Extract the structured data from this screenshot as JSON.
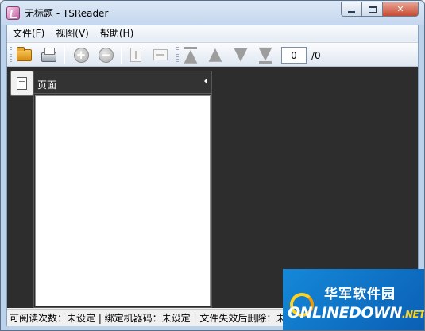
{
  "window": {
    "title": "无标题 - TSReader"
  },
  "menu": [
    "文件(F)",
    "视图(V)",
    "帮助(H)"
  ],
  "toolbar": {
    "buttons": [
      {
        "name": "open-icon"
      },
      {
        "name": "print-icon"
      },
      {
        "name": "zoom-in-icon"
      },
      {
        "name": "zoom-out-icon"
      },
      {
        "name": "fit-height-icon"
      },
      {
        "name": "fit-width-icon"
      },
      {
        "name": "first-page-icon"
      },
      {
        "name": "prev-page-icon"
      },
      {
        "name": "next-page-icon"
      },
      {
        "name": "last-page-icon"
      }
    ],
    "page_input_value": "0",
    "page_total": "/0"
  },
  "panel": {
    "title": "页面"
  },
  "status": {
    "text": "可阅读次数：未设定 | 绑定机器码：未设定 | 文件失效后删除：未"
  },
  "watermark": {
    "top": "华军软件园",
    "bottom": "ONLINEDOWN",
    "suffix": ".NET"
  },
  "colors": {
    "content_bg": "#2d2d2d",
    "watermark_bg": "#0a6fc8",
    "watermark_accent": "#ffd21f"
  }
}
